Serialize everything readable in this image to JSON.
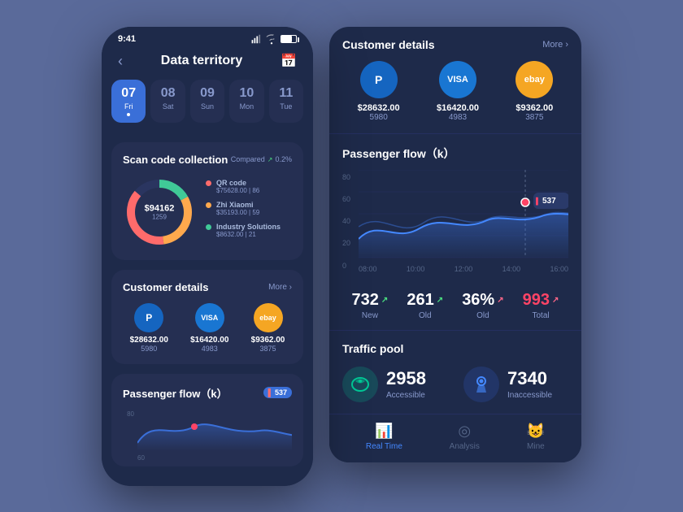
{
  "left_phone": {
    "status_time": "9:41",
    "title": "Data territory",
    "dates": [
      {
        "num": "07",
        "day": "Fri",
        "active": true
      },
      {
        "num": "08",
        "day": "Sat",
        "active": false
      },
      {
        "num": "09",
        "day": "Sun",
        "active": false
      },
      {
        "num": "10",
        "day": "Mon",
        "active": false
      },
      {
        "num": "11",
        "day": "Tue",
        "active": false
      }
    ],
    "scan": {
      "title": "Scan code collection",
      "compared": "Compared",
      "percent": "0.2%",
      "amount": "$94162.00",
      "count": "1259",
      "legend": [
        {
          "color": "#ff6b6b",
          "label": "QR code",
          "val": "$75628.00",
          "count": "86"
        },
        {
          "color": "#ffa94d",
          "label": "Zhi Xiaomi",
          "val": "$35193.00",
          "count": "59"
        },
        {
          "color": "#40c997",
          "label": "Industry Solutions",
          "val": "$8632.00",
          "count": "21"
        }
      ]
    },
    "customers": {
      "title": "Customer details",
      "more": "More",
      "payments": [
        {
          "name": "PayPal",
          "bg": "#1565C0",
          "symbol": "P",
          "amount": "$28632.00",
          "count": "5980"
        },
        {
          "name": "VISA",
          "bg": "#1976D2",
          "symbol": "VISA",
          "amount": "$16420.00",
          "count": "4983"
        },
        {
          "name": "eBay",
          "bg": "#f5a623",
          "symbol": "ebay",
          "amount": "$9362.00",
          "count": "3875"
        }
      ]
    },
    "passenger_flow": {
      "title": "Passenger flow（k）",
      "badge": "537",
      "y_start": "80",
      "y_end": "60"
    }
  },
  "right_panel": {
    "customers": {
      "title": "Customer details",
      "more": "More",
      "payments": [
        {
          "name": "PayPal",
          "bg": "#1565C0",
          "symbol": "P",
          "amount": "$28632.00",
          "count": "5980"
        },
        {
          "name": "VISA",
          "bg": "#1976D2",
          "symbol": "VISA",
          "amount": "$16420.00",
          "count": "4983"
        },
        {
          "name": "eBay",
          "bg": "#f5a623",
          "symbol": "ebay",
          "amount": "$9362.00",
          "count": "3875"
        }
      ]
    },
    "passenger_flow": {
      "title": "Passenger flow（k）",
      "badge_value": "537",
      "y_labels": [
        "80",
        "60",
        "40",
        "20",
        "0"
      ],
      "x_labels": [
        "08:00",
        "10:00",
        "12:00",
        "14:00",
        "16:00"
      ]
    },
    "stats": [
      {
        "num": "732",
        "label": "New",
        "trend": "up",
        "color": "white"
      },
      {
        "num": "261",
        "label": "Old",
        "trend": "up",
        "color": "white"
      },
      {
        "num": "36%",
        "label": "Old",
        "trend": "up_red",
        "color": "white"
      },
      {
        "num": "993",
        "label": "Total",
        "trend": "up_red",
        "color": "red"
      }
    ],
    "traffic": {
      "title": "Traffic pool",
      "items": [
        {
          "num": "2958",
          "label": "Accessible",
          "type": "green"
        },
        {
          "num": "7340",
          "label": "Inaccessible",
          "type": "blue"
        }
      ]
    },
    "nav": [
      {
        "label": "Real Time",
        "active": true,
        "icon": "📊"
      },
      {
        "label": "Analysis",
        "active": false,
        "icon": "⚙"
      },
      {
        "label": "Mine",
        "active": false,
        "icon": "😺"
      }
    ]
  }
}
